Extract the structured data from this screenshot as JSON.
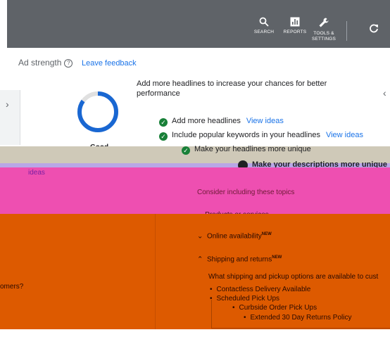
{
  "toolbar": {
    "search": "SEARCH",
    "reports": "REPORTS",
    "tools_line1": "TOOLS &",
    "tools_line2": "SETTINGS"
  },
  "ad_strength": {
    "label": "Ad strength",
    "leave_feedback": "Leave feedback",
    "rating": "Good",
    "ring_fraction": 0.85,
    "intro": "Add more headlines to increase your chances for better performance",
    "suggestions": [
      {
        "text": "Add more headlines",
        "link": "View ideas"
      },
      {
        "text": "Include popular keywords in your headlines",
        "link": "View ideas"
      },
      {
        "text": "Make your headlines more unique",
        "link": ""
      },
      {
        "text": "Make your descriptions more unique",
        "link": ""
      }
    ]
  },
  "ideas": {
    "label": "ideas",
    "consider": "Consider including these topics",
    "sections": [
      {
        "label": "Products or services",
        "new": "",
        "expanded": false
      },
      {
        "label": "Online availability",
        "new": "NEW",
        "expanded": false
      },
      {
        "label": "Shipping and returns",
        "new": "NEW",
        "expanded": true
      }
    ],
    "question": "What shipping and pickup options are available to cust",
    "bullets": [
      "Contactless Delivery Available",
      "Scheduled Pick Ups",
      "Curbside Order Pick Ups",
      "Extended 30 Day Returns Policy"
    ],
    "left_fragment": "omers?"
  },
  "colors": {
    "toolbar": "#5f6368",
    "link": "#1a73e8",
    "check": "#188038",
    "ring": "#1967d2"
  }
}
